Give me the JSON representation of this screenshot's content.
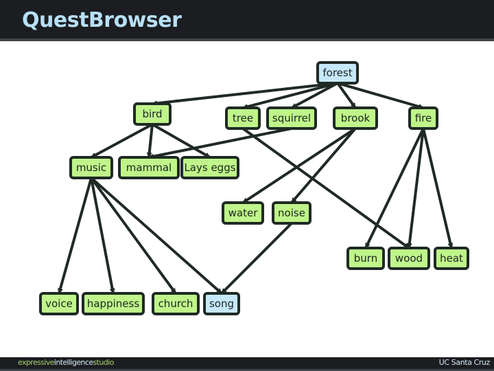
{
  "app": {
    "title": "QuestBrowser",
    "footer_left_parts": [
      "expressive",
      "intelligence",
      "studio"
    ],
    "footer_right": "UC Santa Cruz"
  },
  "colors": {
    "node_default": "#bff58a",
    "node_highlight": "#c6e8fb",
    "edge": "#1f2a24",
    "title": "#b8dff6",
    "bar": "#1b1d20"
  },
  "graph": {
    "nodes": [
      {
        "id": "forest",
        "label": "forest",
        "highlight": true
      },
      {
        "id": "bird",
        "label": "bird",
        "highlight": false
      },
      {
        "id": "tree",
        "label": "tree",
        "highlight": false
      },
      {
        "id": "squirrel",
        "label": "squirrel",
        "highlight": false
      },
      {
        "id": "brook",
        "label": "brook",
        "highlight": false
      },
      {
        "id": "fire",
        "label": "fire",
        "highlight": false
      },
      {
        "id": "music",
        "label": "music",
        "highlight": false
      },
      {
        "id": "mammal",
        "label": "mammal",
        "highlight": false
      },
      {
        "id": "layseggs",
        "label": "Lays eggs",
        "highlight": false
      },
      {
        "id": "water",
        "label": "water",
        "highlight": false
      },
      {
        "id": "noise",
        "label": "noise",
        "highlight": false
      },
      {
        "id": "burn",
        "label": "burn",
        "highlight": false
      },
      {
        "id": "wood",
        "label": "wood",
        "highlight": false
      },
      {
        "id": "heat",
        "label": "heat",
        "highlight": false
      },
      {
        "id": "voice",
        "label": "voice",
        "highlight": false
      },
      {
        "id": "happiness",
        "label": "happiness",
        "highlight": false
      },
      {
        "id": "church",
        "label": "church",
        "highlight": false
      },
      {
        "id": "song",
        "label": "song",
        "highlight": true
      }
    ],
    "edges": [
      {
        "from": "forest",
        "to": "bird"
      },
      {
        "from": "forest",
        "to": "tree"
      },
      {
        "from": "forest",
        "to": "squirrel"
      },
      {
        "from": "forest",
        "to": "brook"
      },
      {
        "from": "forest",
        "to": "fire"
      },
      {
        "from": "bird",
        "to": "music"
      },
      {
        "from": "bird",
        "to": "mammal"
      },
      {
        "from": "bird",
        "to": "layseggs"
      },
      {
        "from": "squirrel",
        "to": "mammal"
      },
      {
        "from": "tree",
        "to": "wood"
      },
      {
        "from": "brook",
        "to": "water"
      },
      {
        "from": "brook",
        "to": "noise"
      },
      {
        "from": "fire",
        "to": "burn"
      },
      {
        "from": "fire",
        "to": "wood"
      },
      {
        "from": "fire",
        "to": "heat"
      },
      {
        "from": "noise",
        "to": "song"
      },
      {
        "from": "music",
        "to": "voice"
      },
      {
        "from": "music",
        "to": "happiness"
      },
      {
        "from": "music",
        "to": "church"
      },
      {
        "from": "music",
        "to": "song"
      }
    ]
  }
}
